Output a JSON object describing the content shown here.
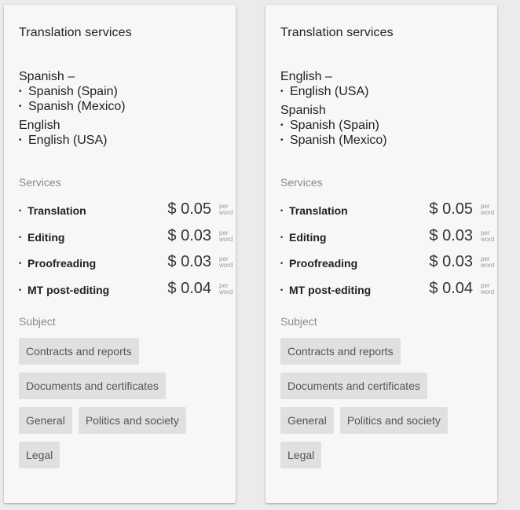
{
  "cards": [
    {
      "title": "Translation services",
      "langs": [
        {
          "head": "Spanish –",
          "items": [
            "Spanish (Spain)",
            "Spanish (Mexico)"
          ]
        },
        {
          "head": "English",
          "items": [
            "English (USA)"
          ]
        }
      ],
      "services_label": "Services",
      "services": [
        {
          "name": "Translation",
          "price": "$ 0.05",
          "unit_top": "per",
          "unit_bottom": "word"
        },
        {
          "name": "Editing",
          "price": "$ 0.03",
          "unit_top": "per",
          "unit_bottom": "word"
        },
        {
          "name": "Proofreading",
          "price": "$ 0.03",
          "unit_top": "per",
          "unit_bottom": "word"
        },
        {
          "name": "MT post-editing",
          "price": "$ 0.04",
          "unit_top": "per",
          "unit_bottom": "word"
        }
      ],
      "subject_label": "Subject",
      "subjects": [
        "Contracts and reports",
        "Documents and certificates",
        "General",
        "Politics and society",
        "Legal"
      ]
    },
    {
      "title": "Translation services",
      "langs": [
        {
          "head": "English –",
          "items": [
            "English (USA)"
          ]
        },
        {
          "head": "Spanish",
          "items": [
            "Spanish (Spain)",
            "Spanish (Mexico)"
          ]
        }
      ],
      "services_label": "Services",
      "services": [
        {
          "name": "Translation",
          "price": "$ 0.05",
          "unit_top": "per",
          "unit_bottom": "word"
        },
        {
          "name": "Editing",
          "price": "$ 0.03",
          "unit_top": "per",
          "unit_bottom": "word"
        },
        {
          "name": "Proofreading",
          "price": "$ 0.03",
          "unit_top": "per",
          "unit_bottom": "word"
        },
        {
          "name": "MT post-editing",
          "price": "$ 0.04",
          "unit_top": "per",
          "unit_bottom": "word"
        }
      ],
      "subject_label": "Subject",
      "subjects": [
        "Contracts and reports",
        "Documents and certificates",
        "General",
        "Politics and society",
        "Legal"
      ]
    }
  ],
  "bullet": "•"
}
